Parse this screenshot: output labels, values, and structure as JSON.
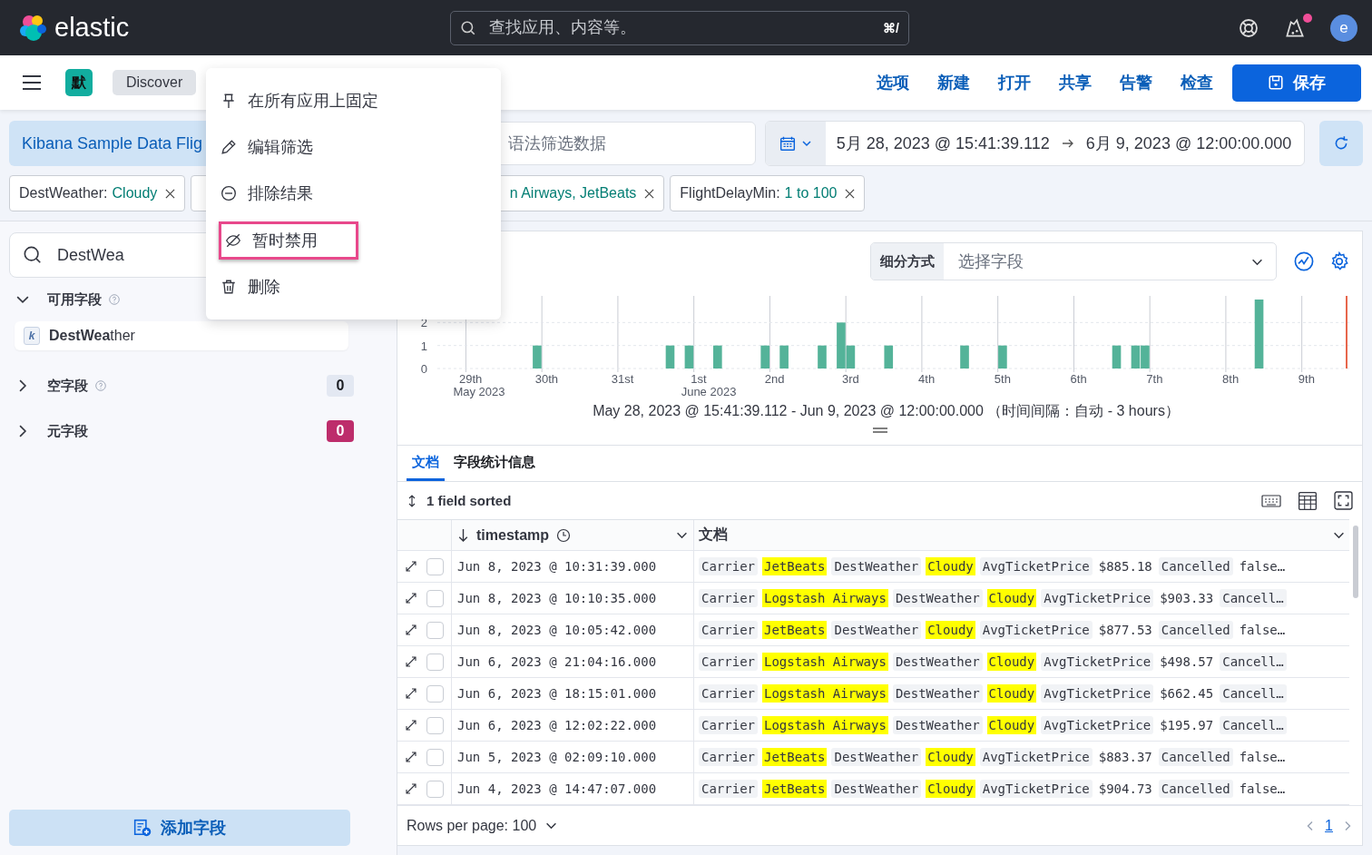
{
  "header": {
    "logo_text": "elastic",
    "search": {
      "placeholder": "查找应用、内容等。",
      "shortcut": "⌘/"
    },
    "alerts_unread": true,
    "avatar": "e"
  },
  "nav": {
    "space": "默",
    "breadcrumb": "Discover",
    "links": [
      "选项",
      "新建",
      "打开",
      "共享",
      "告警",
      "检查"
    ],
    "save_button": "保存"
  },
  "query": {
    "data_view": "Kibana Sample Data Flig",
    "placeholder": "语法筛选数据",
    "start": "5月 28, 2023 @ 15:41:39.112",
    "end": "6月 9, 2023 @ 12:00:00.000"
  },
  "filters": [
    {
      "field": "DestWeather:",
      "value": "Cloudy"
    },
    {
      "value": "n Airways, JetBeats"
    },
    {
      "field": "FlightDelayMin:",
      "value": "1 to 100"
    }
  ],
  "context_menu": {
    "items": [
      {
        "kind": "pin",
        "label": "在所有应用上固定",
        "highlighted": false
      },
      {
        "kind": "edit",
        "label": "编辑筛选",
        "highlighted": false
      },
      {
        "kind": "exclude",
        "label": "排除结果",
        "highlighted": false
      },
      {
        "kind": "disable",
        "label": "暂时禁用",
        "highlighted": true
      },
      {
        "kind": "delete",
        "label": "删除",
        "highlighted": false
      }
    ]
  },
  "sidebar": {
    "search_value": "DestWea",
    "sections": [
      {
        "title": "可用字段",
        "expanded": true,
        "help": true,
        "fields": [
          {
            "type": "k",
            "name": "**DestWea**ther"
          }
        ]
      },
      {
        "title": "空字段",
        "expanded": false,
        "help": true,
        "count": "0",
        "color": "#e3e8f2"
      },
      {
        "title": "元字段",
        "expanded": false,
        "help": false,
        "count": "0",
        "color": "#bd2d6b"
      }
    ],
    "add_button": "添加字段"
  },
  "histogram": {
    "breakdown_label": "细分方式",
    "breakdown_placeholder": "选择字段",
    "chart_data": {
      "type": "bar",
      "categories": [
        null,
        null,
        null,
        "29th",
        null,
        null,
        null,
        null,
        null,
        null,
        null,
        "30th",
        null,
        null,
        null,
        null,
        null,
        null,
        null,
        "31st",
        null,
        null,
        null,
        null,
        null,
        null,
        null,
        "1st",
        null,
        null,
        null,
        null,
        null,
        null,
        null,
        "2nd",
        null,
        null,
        null,
        null,
        null,
        null,
        null,
        "3rd",
        null,
        null,
        null,
        null,
        null,
        null,
        null,
        "4th",
        null,
        null,
        null,
        null,
        null,
        null,
        null,
        "5th",
        null,
        null,
        null,
        null,
        null,
        null,
        null,
        "6th",
        null,
        null,
        null,
        null,
        null,
        null,
        null,
        "7th",
        null,
        null,
        null,
        null,
        null,
        null,
        null,
        "8th",
        null,
        null,
        null,
        null,
        null,
        null,
        null,
        "9th",
        null,
        null,
        null,
        null
      ],
      "values": [
        0,
        0,
        0,
        0,
        0,
        0,
        0,
        0,
        0,
        0,
        1,
        0,
        0,
        0,
        0,
        0,
        0,
        0,
        0,
        0,
        0,
        0,
        0,
        0,
        1,
        0,
        1,
        0,
        0,
        1,
        0,
        0,
        0,
        0,
        1,
        0,
        1,
        0,
        0,
        0,
        1,
        0,
        2,
        1,
        0,
        0,
        0,
        1,
        0,
        0,
        0,
        0,
        0,
        0,
        0,
        1,
        0,
        0,
        0,
        1,
        0,
        0,
        0,
        0,
        0,
        0,
        0,
        0,
        0,
        0,
        0,
        1,
        0,
        1,
        1,
        0,
        0,
        0,
        0,
        0,
        0,
        0,
        0,
        0,
        0,
        0,
        3,
        0,
        0,
        0,
        0,
        0,
        0,
        0,
        0,
        0
      ],
      "ylim": [
        0,
        3
      ],
      "yticks": [
        0,
        1,
        2
      ],
      "annotations": [
        "May 2023",
        "June 2023"
      ]
    },
    "caption": "May 28, 2023 @ 15:41:39.112 - Jun 9, 2023 @ 12:00:00.000 （时间间隔：自动 - 3 hours）"
  },
  "tabs": [
    {
      "label": "文档",
      "selected": true
    },
    {
      "label": "字段统计信息",
      "selected": false
    }
  ],
  "grid": {
    "sort_summary": "1 field sorted",
    "columns": [
      {
        "label": "timestamp",
        "sorted": true
      },
      {
        "label": "文档",
        "sorted": false
      }
    ],
    "rows": [
      {
        "checked": false,
        "timestamp": "Jun 8, 2023 @ 10:31:39.000",
        "document": [
          {
            "key": "Carrier",
            "value": "JetBeats",
            "match": true
          },
          {
            "key": "DestWeather",
            "value": "Cloudy",
            "match": true
          },
          {
            "key": "AvgTicketPrice",
            "value": "$885.18",
            "match": false
          },
          {
            "key": "Cancelled",
            "value": "false…",
            "match": false
          }
        ]
      },
      {
        "checked": false,
        "timestamp": "Jun 8, 2023 @ 10:10:35.000",
        "document": [
          {
            "key": "Carrier",
            "value": "Logstash Airways",
            "match": true
          },
          {
            "key": "DestWeather",
            "value": "Cloudy",
            "match": true
          },
          {
            "key": "AvgTicketPrice",
            "value": "$903.33",
            "match": false
          },
          {
            "key": "Cancell…"
          }
        ]
      },
      {
        "checked": false,
        "timestamp": "Jun 8, 2023 @ 10:05:42.000",
        "document": [
          {
            "key": "Carrier",
            "value": "JetBeats",
            "match": true
          },
          {
            "key": "DestWeather",
            "value": "Cloudy",
            "match": true
          },
          {
            "key": "AvgTicketPrice",
            "value": "$877.53",
            "match": false
          },
          {
            "key": "Cancelled",
            "value": "false…",
            "match": false
          }
        ]
      },
      {
        "checked": false,
        "timestamp": "Jun 6, 2023 @ 21:04:16.000",
        "document": [
          {
            "key": "Carrier",
            "value": "Logstash Airways",
            "match": true
          },
          {
            "key": "DestWeather",
            "value": "Cloudy",
            "match": true
          },
          {
            "key": "AvgTicketPrice",
            "value": "$498.57",
            "match": false
          },
          {
            "key": "Cancell…"
          }
        ]
      },
      {
        "checked": false,
        "timestamp": "Jun 6, 2023 @ 18:15:01.000",
        "document": [
          {
            "key": "Carrier",
            "value": "Logstash Airways",
            "match": true
          },
          {
            "key": "DestWeather",
            "value": "Cloudy",
            "match": true
          },
          {
            "key": "AvgTicketPrice",
            "value": "$662.45",
            "match": false
          },
          {
            "key": "Cancell…"
          }
        ]
      },
      {
        "checked": false,
        "timestamp": "Jun 6, 2023 @ 12:02:22.000",
        "document": [
          {
            "key": "Carrier",
            "value": "Logstash Airways",
            "match": true
          },
          {
            "key": "DestWeather",
            "value": "Cloudy",
            "match": true
          },
          {
            "key": "AvgTicketPrice",
            "value": "$195.97",
            "match": false
          },
          {
            "key": "Cancell…"
          }
        ]
      },
      {
        "checked": false,
        "timestamp": "Jun 5, 2023 @ 02:09:10.000",
        "document": [
          {
            "key": "Carrier",
            "value": "JetBeats",
            "match": true
          },
          {
            "key": "DestWeather",
            "value": "Cloudy",
            "match": true
          },
          {
            "key": "AvgTicketPrice",
            "value": "$883.37",
            "match": false
          },
          {
            "key": "Cancelled",
            "value": "false…",
            "match": false
          }
        ]
      },
      {
        "checked": false,
        "timestamp": "Jun 4, 2023 @ 14:47:07.000",
        "document": [
          {
            "key": "Carrier",
            "value": "JetBeats",
            "match": true
          },
          {
            "key": "DestWeather",
            "value": "Cloudy",
            "match": true
          },
          {
            "key": "AvgTicketPrice",
            "value": "$904.73",
            "match": false
          },
          {
            "key": "Cancelled",
            "value": "false…",
            "match": false
          }
        ]
      }
    ],
    "rows_per_page": "Rows per page: 100",
    "page": "1"
  }
}
